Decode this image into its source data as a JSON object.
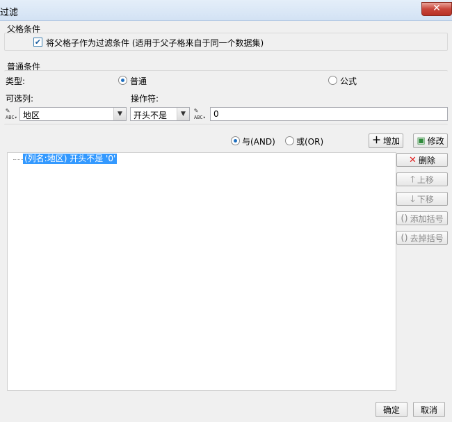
{
  "window": {
    "title": "过滤"
  },
  "parent_condition": {
    "group_label": "父格条件",
    "checkbox_label": "将父格子作为过滤条件 (适用于父子格来自于同一个数据集)",
    "checked": true
  },
  "normal_condition": {
    "group_label": "普通条件",
    "type_label": "类型:",
    "type_options": [
      {
        "label": "普通",
        "selected": true
      },
      {
        "label": "公式",
        "selected": false
      }
    ],
    "column_label": "可选列:",
    "column_value": "地区",
    "operator_label": "操作符:",
    "operator_value": "开头不是",
    "value_input": "0"
  },
  "logic": {
    "and_label": "与(AND)",
    "or_label": "或(OR)",
    "selected": "and"
  },
  "buttons": {
    "add": "增加",
    "modify": "修改",
    "delete": "删除",
    "move_up": "上移",
    "move_down": "下移",
    "add_bracket": "添加括号",
    "remove_bracket": "去掉括号",
    "ok": "确定",
    "cancel": "取消"
  },
  "conditions": [
    {
      "text": "(列名:地区) 开头不是 '0'",
      "selected": true
    }
  ],
  "icons": {
    "close": "close-icon",
    "add": "plus-icon",
    "modify": "edit-icon",
    "delete": "red-x-icon",
    "up": "arrow-up-icon",
    "down": "arrow-down-icon",
    "add_bracket": "add-bracket-icon",
    "remove_bracket": "remove-bracket-icon",
    "column_type": "abc-type-icon",
    "value_type": "abc-type-icon"
  },
  "colors": {
    "selection": "#3399ff",
    "close_button": "#c8453a",
    "delete_icon": "#e02020",
    "modify_icon": "#2e8b3a"
  }
}
